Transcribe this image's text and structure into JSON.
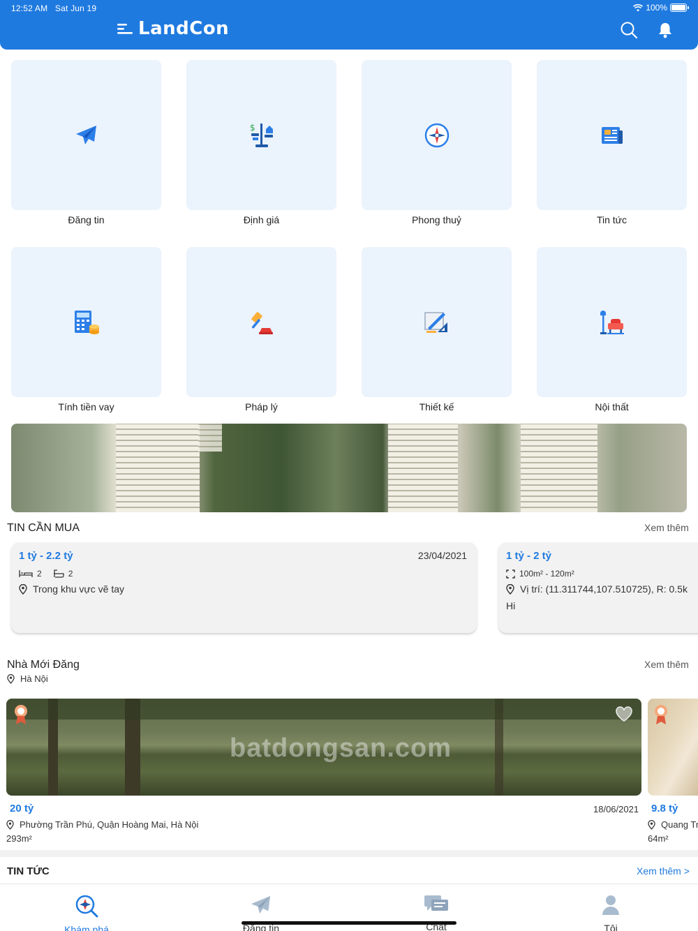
{
  "status": {
    "time": "12:52 AM",
    "date": "Sat Jun 19",
    "battery": "100%"
  },
  "header": {
    "logo": "LandCon",
    "logo_icon": "menu-lines-icon",
    "search_icon": "search-icon",
    "bell_icon": "bell-icon"
  },
  "services": [
    {
      "label": "Đăng tin",
      "icon": "paper-plane-icon"
    },
    {
      "label": "Định giá",
      "icon": "price-scale-icon"
    },
    {
      "label": "Phong thuỷ",
      "icon": "compass-icon"
    },
    {
      "label": "Tin tức",
      "icon": "newspaper-icon"
    },
    {
      "label": "Tính tiền vay",
      "icon": "calculator-coins-icon"
    },
    {
      "label": "Pháp lý",
      "icon": "gavel-icon"
    },
    {
      "label": "Thiết kế",
      "icon": "design-ruler-icon"
    },
    {
      "label": "Nội thất",
      "icon": "armchair-lamp-icon"
    }
  ],
  "buy_section": {
    "title": "TIN CẦN MUA",
    "more": "Xem thêm",
    "cards": [
      {
        "price": "1 tỷ - 2.2 tỷ",
        "date": "23/04/2021",
        "beds": "2",
        "baths": "2",
        "location": "Trong khu vực vẽ tay",
        "note": ""
      },
      {
        "price": "1 tỷ - 2 tỷ",
        "date": "",
        "area": "100m² - 120m²",
        "location": "Vị trí: (11.311744,107.510725), R: 0.5k",
        "note": "Hi"
      }
    ]
  },
  "new_section": {
    "title": "Nhà Mới Đăng",
    "city": "Hà Nội",
    "more": "Xem thêm",
    "listings": [
      {
        "price": "20 tỷ",
        "date": "18/06/2021",
        "address": "Phường Trần Phú, Quận Hoàng Mai, Hà Nội",
        "area": "293m²",
        "watermark": "batdongsan.com"
      },
      {
        "price": "9.8 tỷ",
        "address": "Quang Tr",
        "area": "64m²"
      }
    ]
  },
  "news_section": {
    "title": "TIN TỨC",
    "more": "Xem thêm >"
  },
  "tabs": [
    {
      "label": "Khám phá",
      "icon": "explore-icon",
      "active": true
    },
    {
      "label": "Đăng tin",
      "icon": "send-icon",
      "active": false
    },
    {
      "label": "Chat",
      "icon": "chat-icon",
      "active": false
    },
    {
      "label": "Tôi",
      "icon": "user-icon",
      "active": false
    }
  ],
  "colors": {
    "primary": "#1f7ae0",
    "tile_bg": "#ebf3fd",
    "card_bg": "#f2f2f2"
  }
}
